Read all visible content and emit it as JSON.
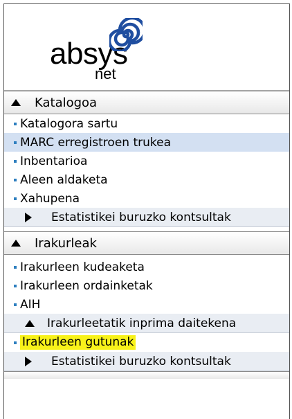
{
  "logo": {
    "word": "absys",
    "sub": "net",
    "accent_color": "#1f4ea0"
  },
  "menu": {
    "sections": [
      {
        "label": "Katalogoa",
        "expanded": true,
        "items": [
          {
            "label": "Katalogora sartu"
          },
          {
            "label": "MARC erregistroen trukea",
            "active": true
          },
          {
            "label": "Inbentarioa"
          },
          {
            "label": "Aleen aldaketa"
          },
          {
            "label": "Xahupena"
          }
        ],
        "subsection": {
          "label": "Estatistikei buruzko kontsultak",
          "expanded": false
        }
      },
      {
        "label": "Irakurleak",
        "expanded": true,
        "items": [
          {
            "label": "Irakurleen kudeaketa"
          },
          {
            "label": "Irakurleen ordainketak"
          },
          {
            "label": "AIH"
          }
        ],
        "subsection_open": {
          "label": "Irakurleetatik inprima daitekena",
          "expanded": true
        },
        "subsection_items": [
          {
            "label": "Irakurleen gutunak",
            "highlighted": true,
            "highlight_color": "#f8f21a"
          }
        ],
        "subsection": {
          "label": "Estatistikei buruzko kontsultak",
          "expanded": false
        }
      }
    ]
  }
}
